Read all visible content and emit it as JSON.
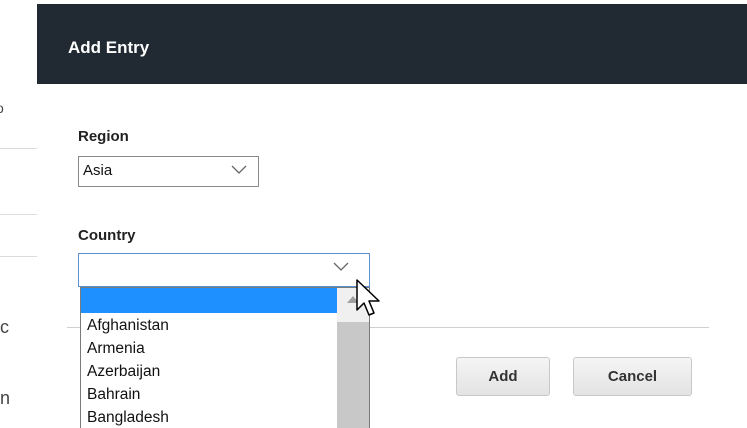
{
  "background": {
    "fragments": [
      "o",
      "c",
      "n"
    ]
  },
  "dialog": {
    "title": "Add Entry",
    "region": {
      "label": "Region",
      "value": "Asia"
    },
    "country": {
      "label": "Country",
      "value": ""
    },
    "buttons": {
      "add": "Add",
      "cancel": "Cancel"
    }
  },
  "country_dropdown": {
    "options": [
      "",
      "Afghanistan",
      "Armenia",
      "Azerbaijan",
      "Bahrain",
      "Bangladesh"
    ],
    "highlighted_index": 0
  },
  "colors": {
    "header": "#212a33",
    "highlight": "#1e90ff"
  },
  "icons": [
    "chevron-down-icon",
    "scroll-up-icon",
    "mouse-cursor-icon"
  ]
}
